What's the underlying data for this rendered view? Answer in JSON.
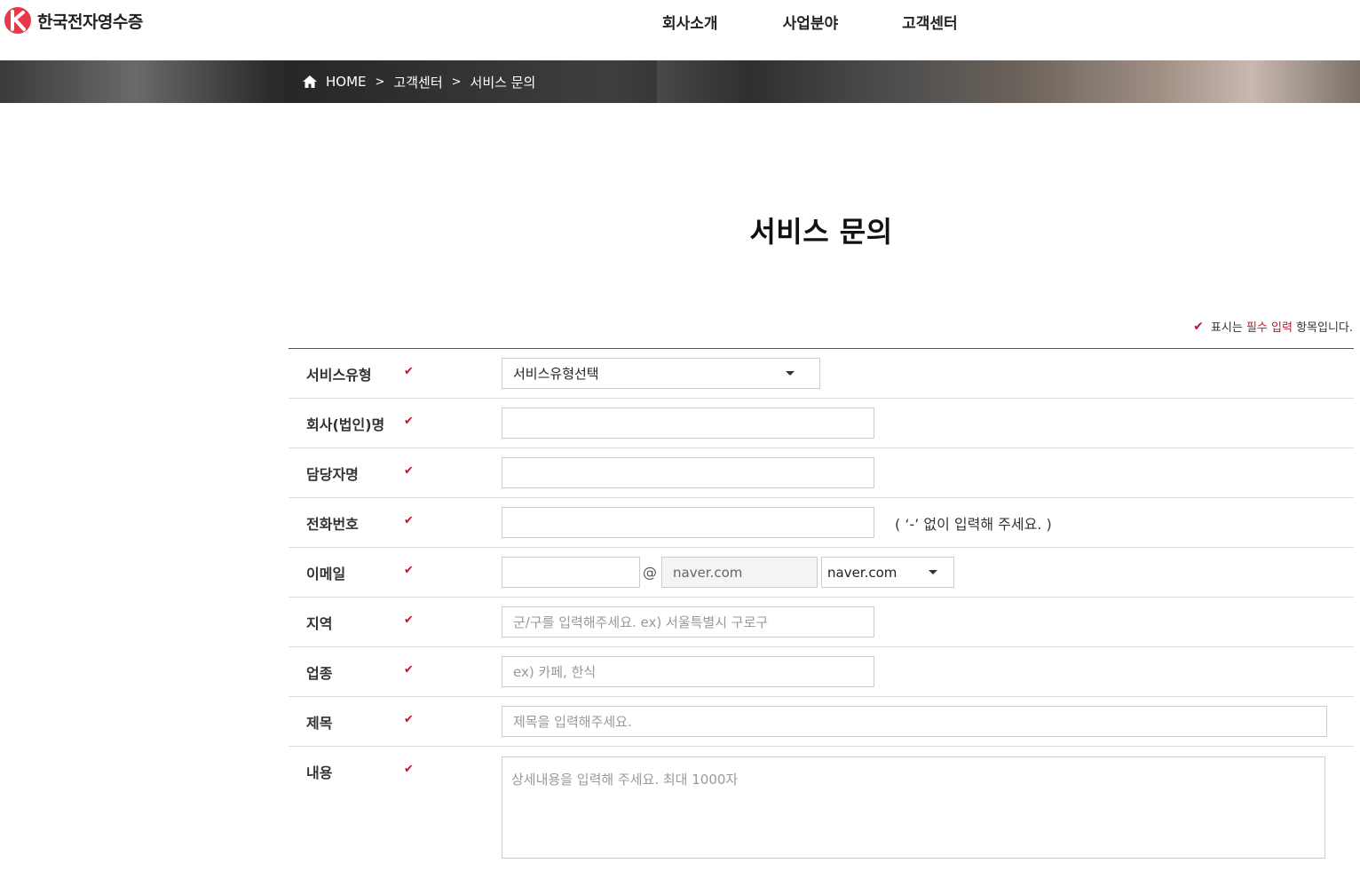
{
  "header": {
    "logo_text": "한국전자영수증",
    "nav": [
      "회사소개",
      "사업분야",
      "고객센터"
    ]
  },
  "breadcrumb": {
    "home": "HOME",
    "level1": "고객센터",
    "level2": "서비스 문의",
    "separator": ">"
  },
  "page": {
    "title": "서비스 문의"
  },
  "required_note": {
    "check": "✔",
    "prefix": "표시는",
    "highlight": "필수 입력",
    "suffix": "항목입니다."
  },
  "form": {
    "check": "✔",
    "service_type": {
      "label": "서비스유형",
      "value": "서비스유형선택"
    },
    "company": {
      "label": "회사(법인)명",
      "value": ""
    },
    "manager": {
      "label": "담당자명",
      "value": ""
    },
    "phone": {
      "label": "전화번호",
      "value": "",
      "hint": "( ‘-’ 없이 입력해 주세요. )"
    },
    "email": {
      "label": "이메일",
      "local": "",
      "at": "@",
      "domain_readonly": "naver.com",
      "domain_select": "naver.com"
    },
    "region": {
      "label": "지역",
      "placeholder": "군/구를 입력해주세요. ex) 서울특별시 구로구"
    },
    "industry": {
      "label": "업종",
      "placeholder": "ex) 카페, 한식"
    },
    "subject": {
      "label": "제목",
      "placeholder": "제목을 입력해주세요."
    },
    "content": {
      "label": "내용",
      "placeholder": "상세내용을 입력해 주세요. 최대 1000자"
    }
  },
  "colors": {
    "accent": "#c8102e"
  }
}
